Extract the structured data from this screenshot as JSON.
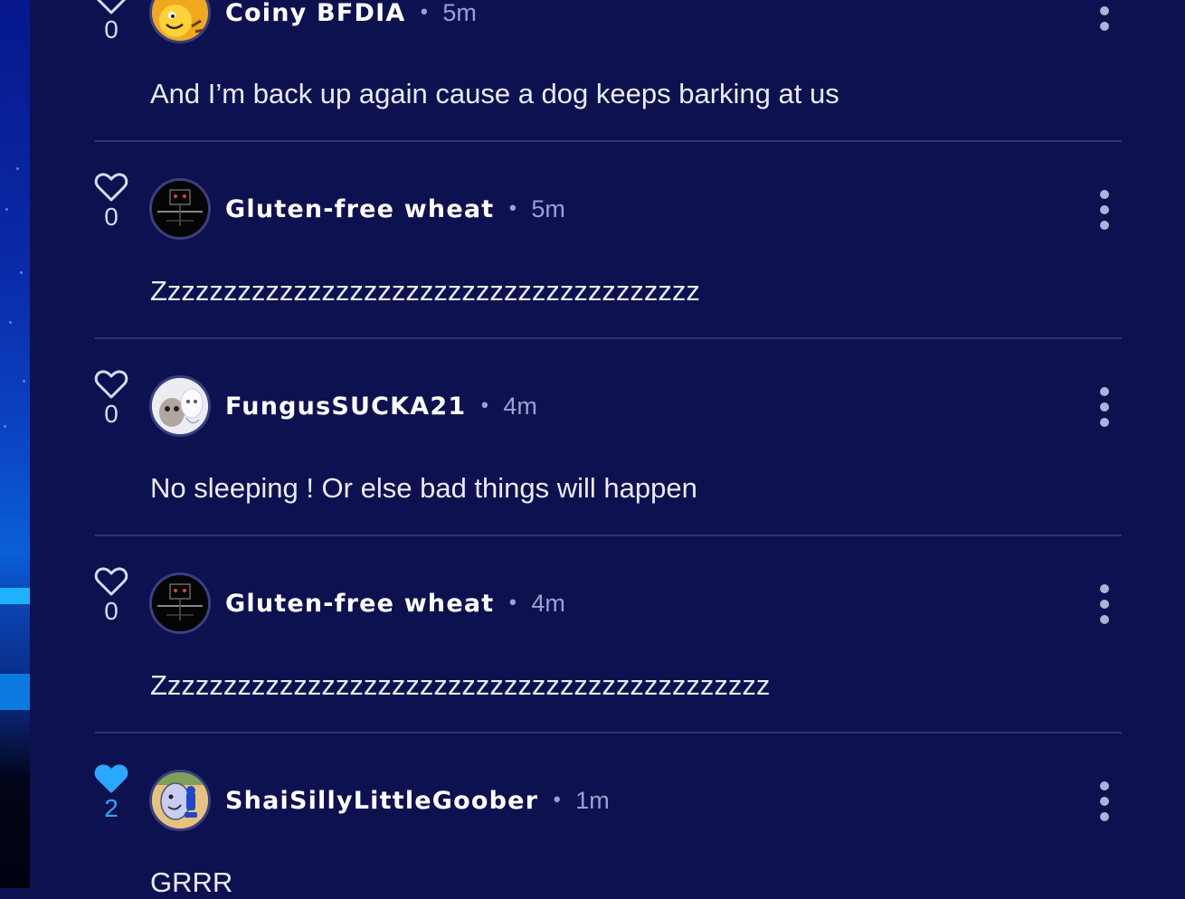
{
  "colors": {
    "background": "#0e1150",
    "divider": "#2e3575",
    "liked": "#2aa8ff",
    "meta": "#9aa1d0"
  },
  "comments": [
    {
      "username": "Coiny BFDIA",
      "separator": "•",
      "time": "5m",
      "text": "And I’m back up again cause a dog keeps barking at us",
      "likes": "0",
      "liked": false,
      "avatar_icon": "coiny-avatar"
    },
    {
      "username": "Gluten-free wheat",
      "separator": "•",
      "time": "5m",
      "text": "Zzzzzzzzzzzzzzzzzzzzzzzzzzzzzzzzzzzzzzz",
      "likes": "0",
      "liked": false,
      "avatar_icon": "dark-robot-avatar"
    },
    {
      "username": "FungusSUCKA21",
      "separator": "•",
      "time": "4m",
      "text": "No sleeping ! Or else bad things will happen",
      "likes": "0",
      "liked": false,
      "avatar_icon": "white-creature-avatar"
    },
    {
      "username": "Gluten-free wheat",
      "separator": "•",
      "time": "4m",
      "text": "Zzzzzzzzzzzzzzzzzzzzzzzzzzzzzzzzzzzzzzzzzzzz",
      "likes": "0",
      "liked": false,
      "avatar_icon": "dark-robot-avatar"
    },
    {
      "username": "ShaiSillyLittleGoober",
      "separator": "•",
      "time": "1m",
      "text": "GRRR",
      "likes": "2",
      "liked": true,
      "avatar_icon": "blue-character-avatar"
    }
  ]
}
